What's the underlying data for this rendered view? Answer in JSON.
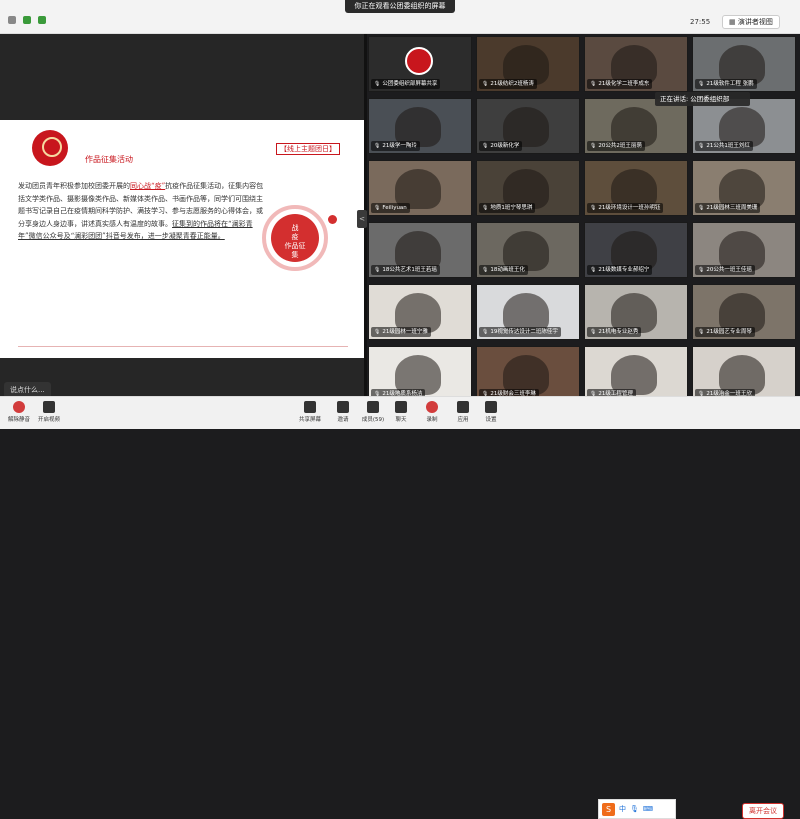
{
  "header": {
    "title": "你正在观看公团委组织的屏幕",
    "timer": "27:55",
    "view_button": "演讲者视图"
  },
  "slide": {
    "heading": "作品征集活动",
    "online_tag": "【线上主题团日】",
    "body_parts": [
      "发动团员青年积极参加校团委开展的",
      "同心战“疫”",
      "抗疫作品征集活动，征集内容包括文学类作品、摄影摄像类作品、新媒体类作品、书画作品等，同学们可围绕主题书写记录自己在疫情期间科学防护、满技学习、参与志愿服务的心得体会，或分享身边人身边事，讲述真实感人有温度的故事。",
      "征集到的作品将在“澜彩青年”微信公众号及“澜彩团团”抖音号发布，进一步凝聚青春正能量。"
    ],
    "stamp_text": [
      "战",
      "疫",
      "作品征",
      "集"
    ]
  },
  "chat_hint": "说点什么...",
  "tooltip": "正在讲话: 公团委组织部",
  "participants": [
    {
      "label": "公团委组织部屏幕共享",
      "c": "#2a2a2a",
      "logo": true
    },
    {
      "label": "21级纺织2班杨涛",
      "c": "#4b3a2c"
    },
    {
      "label": "21级化学二班李成东",
      "c": "#5a4a40"
    },
    {
      "label": "21级软件工程 张鹏",
      "c": "#6b6e70"
    },
    {
      "label": "21级学一陶玲",
      "c": "#4a4f55"
    },
    {
      "label": "20级新化学",
      "c": "#3e3e3e"
    },
    {
      "label": "20公共2班王丽萌",
      "c": "#6e6a5e"
    },
    {
      "label": "21公共1班王刘红",
      "c": "#8c8f92"
    },
    {
      "label": "Feiliyuan",
      "c": "#7a6a5c"
    },
    {
      "label": "地质1班宁琴思琪",
      "c": "#4a4238"
    },
    {
      "label": "21级环境设计一班孙明钰",
      "c": "#5e4e3c"
    },
    {
      "label": "21级园林三班周美珊",
      "c": "#8a7e70"
    },
    {
      "label": "18公共艺术1班王若瑶",
      "c": "#6b6b6b"
    },
    {
      "label": "18动画班王化",
      "c": "#6c6860"
    },
    {
      "label": "21级数媒专业郝绍宁",
      "c": "#3f4045"
    },
    {
      "label": "20公共一班王佳瑶",
      "c": "#8c8680"
    },
    {
      "label": "21级园林一班宁雅",
      "c": "#e0dcd6"
    },
    {
      "label": "19视觉传达设计二班陈佳宇",
      "c": "#d9dadc"
    },
    {
      "label": "21机电专业赵秀",
      "c": "#b7b4ae"
    },
    {
      "label": "21级园艺专业周琴",
      "c": "#7d7469"
    },
    {
      "label": "21级地质系杨洁",
      "c": "#eae8e4"
    },
    {
      "label": "21级财会三班李琳",
      "c": "#6a4e3e"
    },
    {
      "label": "21级工程管理",
      "c": "#dcd8d2"
    },
    {
      "label": "21级冶金一班王欣",
      "c": "#d6d1cb"
    }
  ],
  "toolbar": {
    "items": [
      "共享屏幕",
      "邀请",
      "成员(59)",
      "聊天",
      "录制",
      "应用",
      "设置"
    ],
    "left_items": [
      "解除静音",
      "开启视频"
    ],
    "leave": "离开会议"
  },
  "ime": {
    "label": "中"
  },
  "colors": {
    "accent_red": "#c8161d",
    "leave_red": "#d0312d"
  }
}
